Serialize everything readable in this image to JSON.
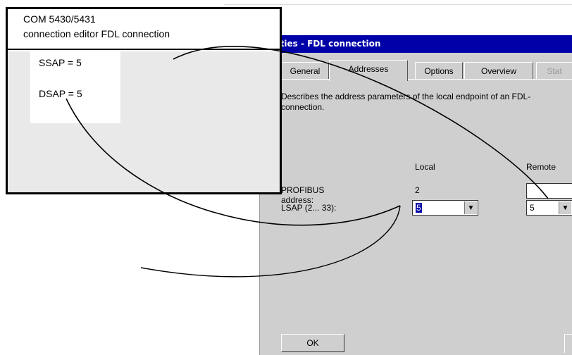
{
  "callout": {
    "line1": "COM 5430/5431",
    "line2": "connection editor FDL connection",
    "ssap": "SSAP = 5",
    "dsap": "DSAP = 5"
  },
  "dialog": {
    "title": "perties - FDL connection",
    "tabs": [
      {
        "label": "General",
        "active": false
      },
      {
        "label": "Addresses",
        "active": true
      },
      {
        "label": "Options",
        "active": false
      },
      {
        "label": "Overview",
        "active": false
      },
      {
        "label": "Stat",
        "active": false,
        "disabled": true
      }
    ],
    "description": "Describes the address parameters of the local endpoint of an FDL-connection.",
    "col_local": "Local",
    "col_remote": "Remote",
    "profibus_label_1": "PROFIBUS",
    "profibus_label_2": "address:",
    "profibus_local_value": "2",
    "lsap_label": "LSAP (2... 33):",
    "lsap_local_value": "5",
    "lsap_remote_value": "5",
    "ok_label": "OK"
  }
}
